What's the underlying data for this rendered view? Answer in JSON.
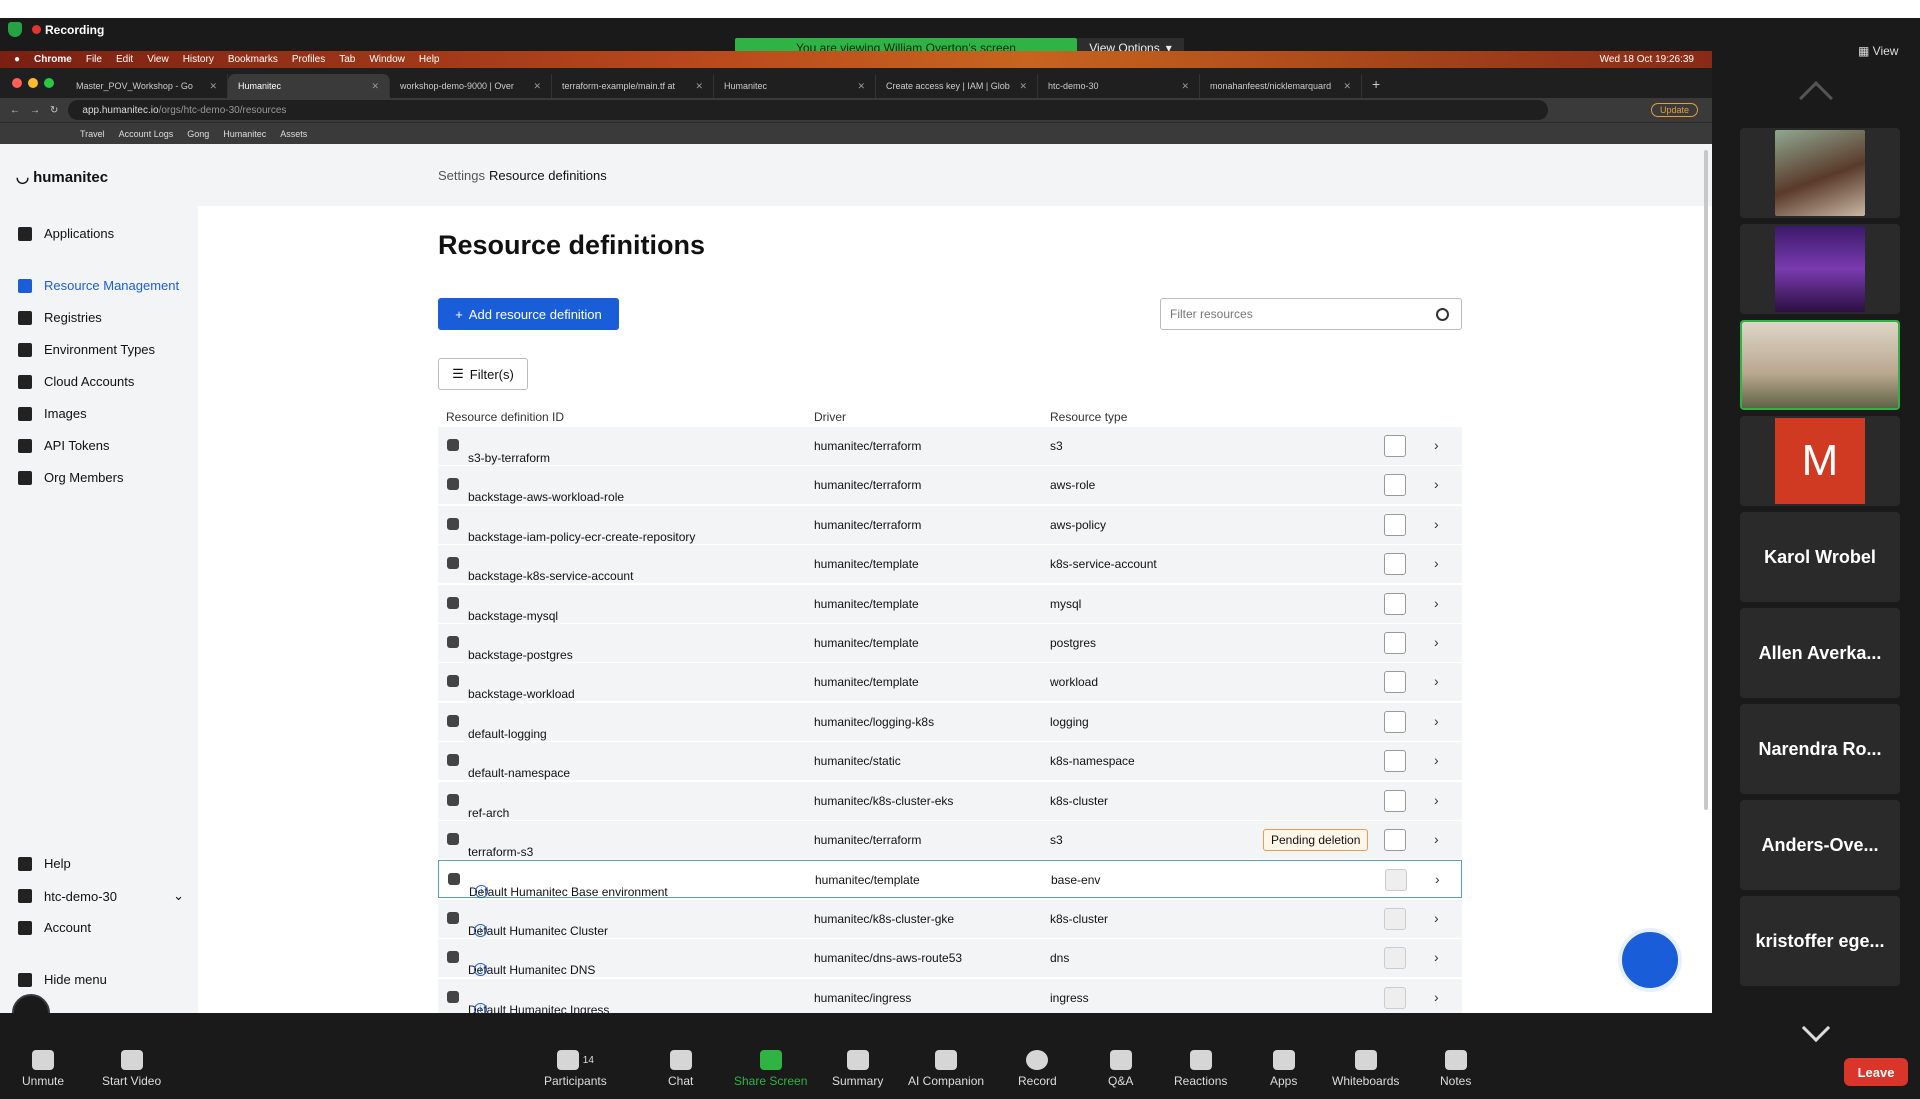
{
  "zoom": {
    "recording": "Recording",
    "viewing": "You are viewing William Overton's screen",
    "view_options": "View Options",
    "view": "View",
    "participants_count": "14",
    "toolbar": [
      "Unmute",
      "Start Video",
      "Participants",
      "Chat",
      "Share Screen",
      "Summary",
      "AI Companion",
      "Record",
      "Q&A",
      "Reactions",
      "Apps",
      "Whiteboards",
      "Notes"
    ],
    "leave": "Leave",
    "gallery": [
      {
        "name": ""
      },
      {
        "name": ""
      },
      {
        "name": ""
      },
      {
        "name": "M"
      },
      {
        "name": "Karol Wrobel"
      },
      {
        "name": "Allen Averka..."
      },
      {
        "name": "Narendra Ro..."
      },
      {
        "name": "Anders-Ove..."
      },
      {
        "name": "kristoffer ege..."
      }
    ]
  },
  "mac": {
    "menu": [
      "Chrome",
      "File",
      "Edit",
      "View",
      "History",
      "Bookmarks",
      "Profiles",
      "Tab",
      "Window",
      "Help"
    ],
    "clock": "Wed 18 Oct  19:26:39"
  },
  "browser": {
    "tabs": [
      "Master_POV_Workshop - Go",
      "Humanitec",
      "workshop-demo-9000 | Over",
      "terraform-example/main.tf at",
      "Humanitec",
      "Create access key | IAM | Glob",
      "htc-demo-30",
      "monahanfeest/nicklemarquard"
    ],
    "url_host": "app.humanitec.io",
    "url_path": "/orgs/htc-demo-30/resources",
    "update": "Update",
    "bookmarks": [
      "Travel",
      "Account Logs",
      "Gong",
      "Humanitec",
      "Assets"
    ]
  },
  "app": {
    "logo": "humanitec",
    "nav": [
      "Applications",
      "Resource Management",
      "Registries",
      "Environment Types",
      "Cloud Accounts",
      "Images",
      "API Tokens",
      "Org Members"
    ],
    "bottom_nav": [
      "Help",
      "htc-demo-30",
      "Account",
      "Hide menu"
    ],
    "breadcrumb": {
      "parent": "Settings",
      "current": "Resource definitions"
    },
    "title": "Resource definitions",
    "add_button": "Add resource definition",
    "filter_placeholder": "Filter resources",
    "filters_button": "Filter(s)",
    "headers": [
      "Resource definition ID",
      "Driver",
      "Resource type"
    ],
    "pending_label": "Pending deletion",
    "rows": [
      {
        "id": "s3-by-terraform",
        "driver": "humanitec/terraform",
        "type": "s3"
      },
      {
        "id": "backstage-aws-workload-role",
        "driver": "humanitec/terraform",
        "type": "aws-role"
      },
      {
        "id": "backstage-iam-policy-ecr-create-repository",
        "driver": "humanitec/terraform",
        "type": "aws-policy"
      },
      {
        "id": "backstage-k8s-service-account",
        "driver": "humanitec/template",
        "type": "k8s-service-account"
      },
      {
        "id": "backstage-mysql",
        "driver": "humanitec/template",
        "type": "mysql"
      },
      {
        "id": "backstage-postgres",
        "driver": "humanitec/template",
        "type": "postgres"
      },
      {
        "id": "backstage-workload",
        "driver": "humanitec/template",
        "type": "workload"
      },
      {
        "id": "default-logging",
        "driver": "humanitec/logging-k8s",
        "type": "logging"
      },
      {
        "id": "default-namespace",
        "driver": "humanitec/static",
        "type": "k8s-namespace"
      },
      {
        "id": "ref-arch",
        "driver": "humanitec/k8s-cluster-eks",
        "type": "k8s-cluster"
      },
      {
        "id": "terraform-s3",
        "driver": "humanitec/terraform",
        "type": "s3"
      },
      {
        "id": "Default Humanitec Base environment",
        "driver": "humanitec/template",
        "type": "base-env"
      },
      {
        "id": "Default Humanitec Cluster",
        "driver": "humanitec/k8s-cluster-gke",
        "type": "k8s-cluster"
      },
      {
        "id": "Default Humanitec DNS",
        "driver": "humanitec/dns-aws-route53",
        "type": "dns"
      },
      {
        "id": "Default Humanitec Ingress",
        "driver": "humanitec/ingress",
        "type": "ingress"
      }
    ]
  }
}
